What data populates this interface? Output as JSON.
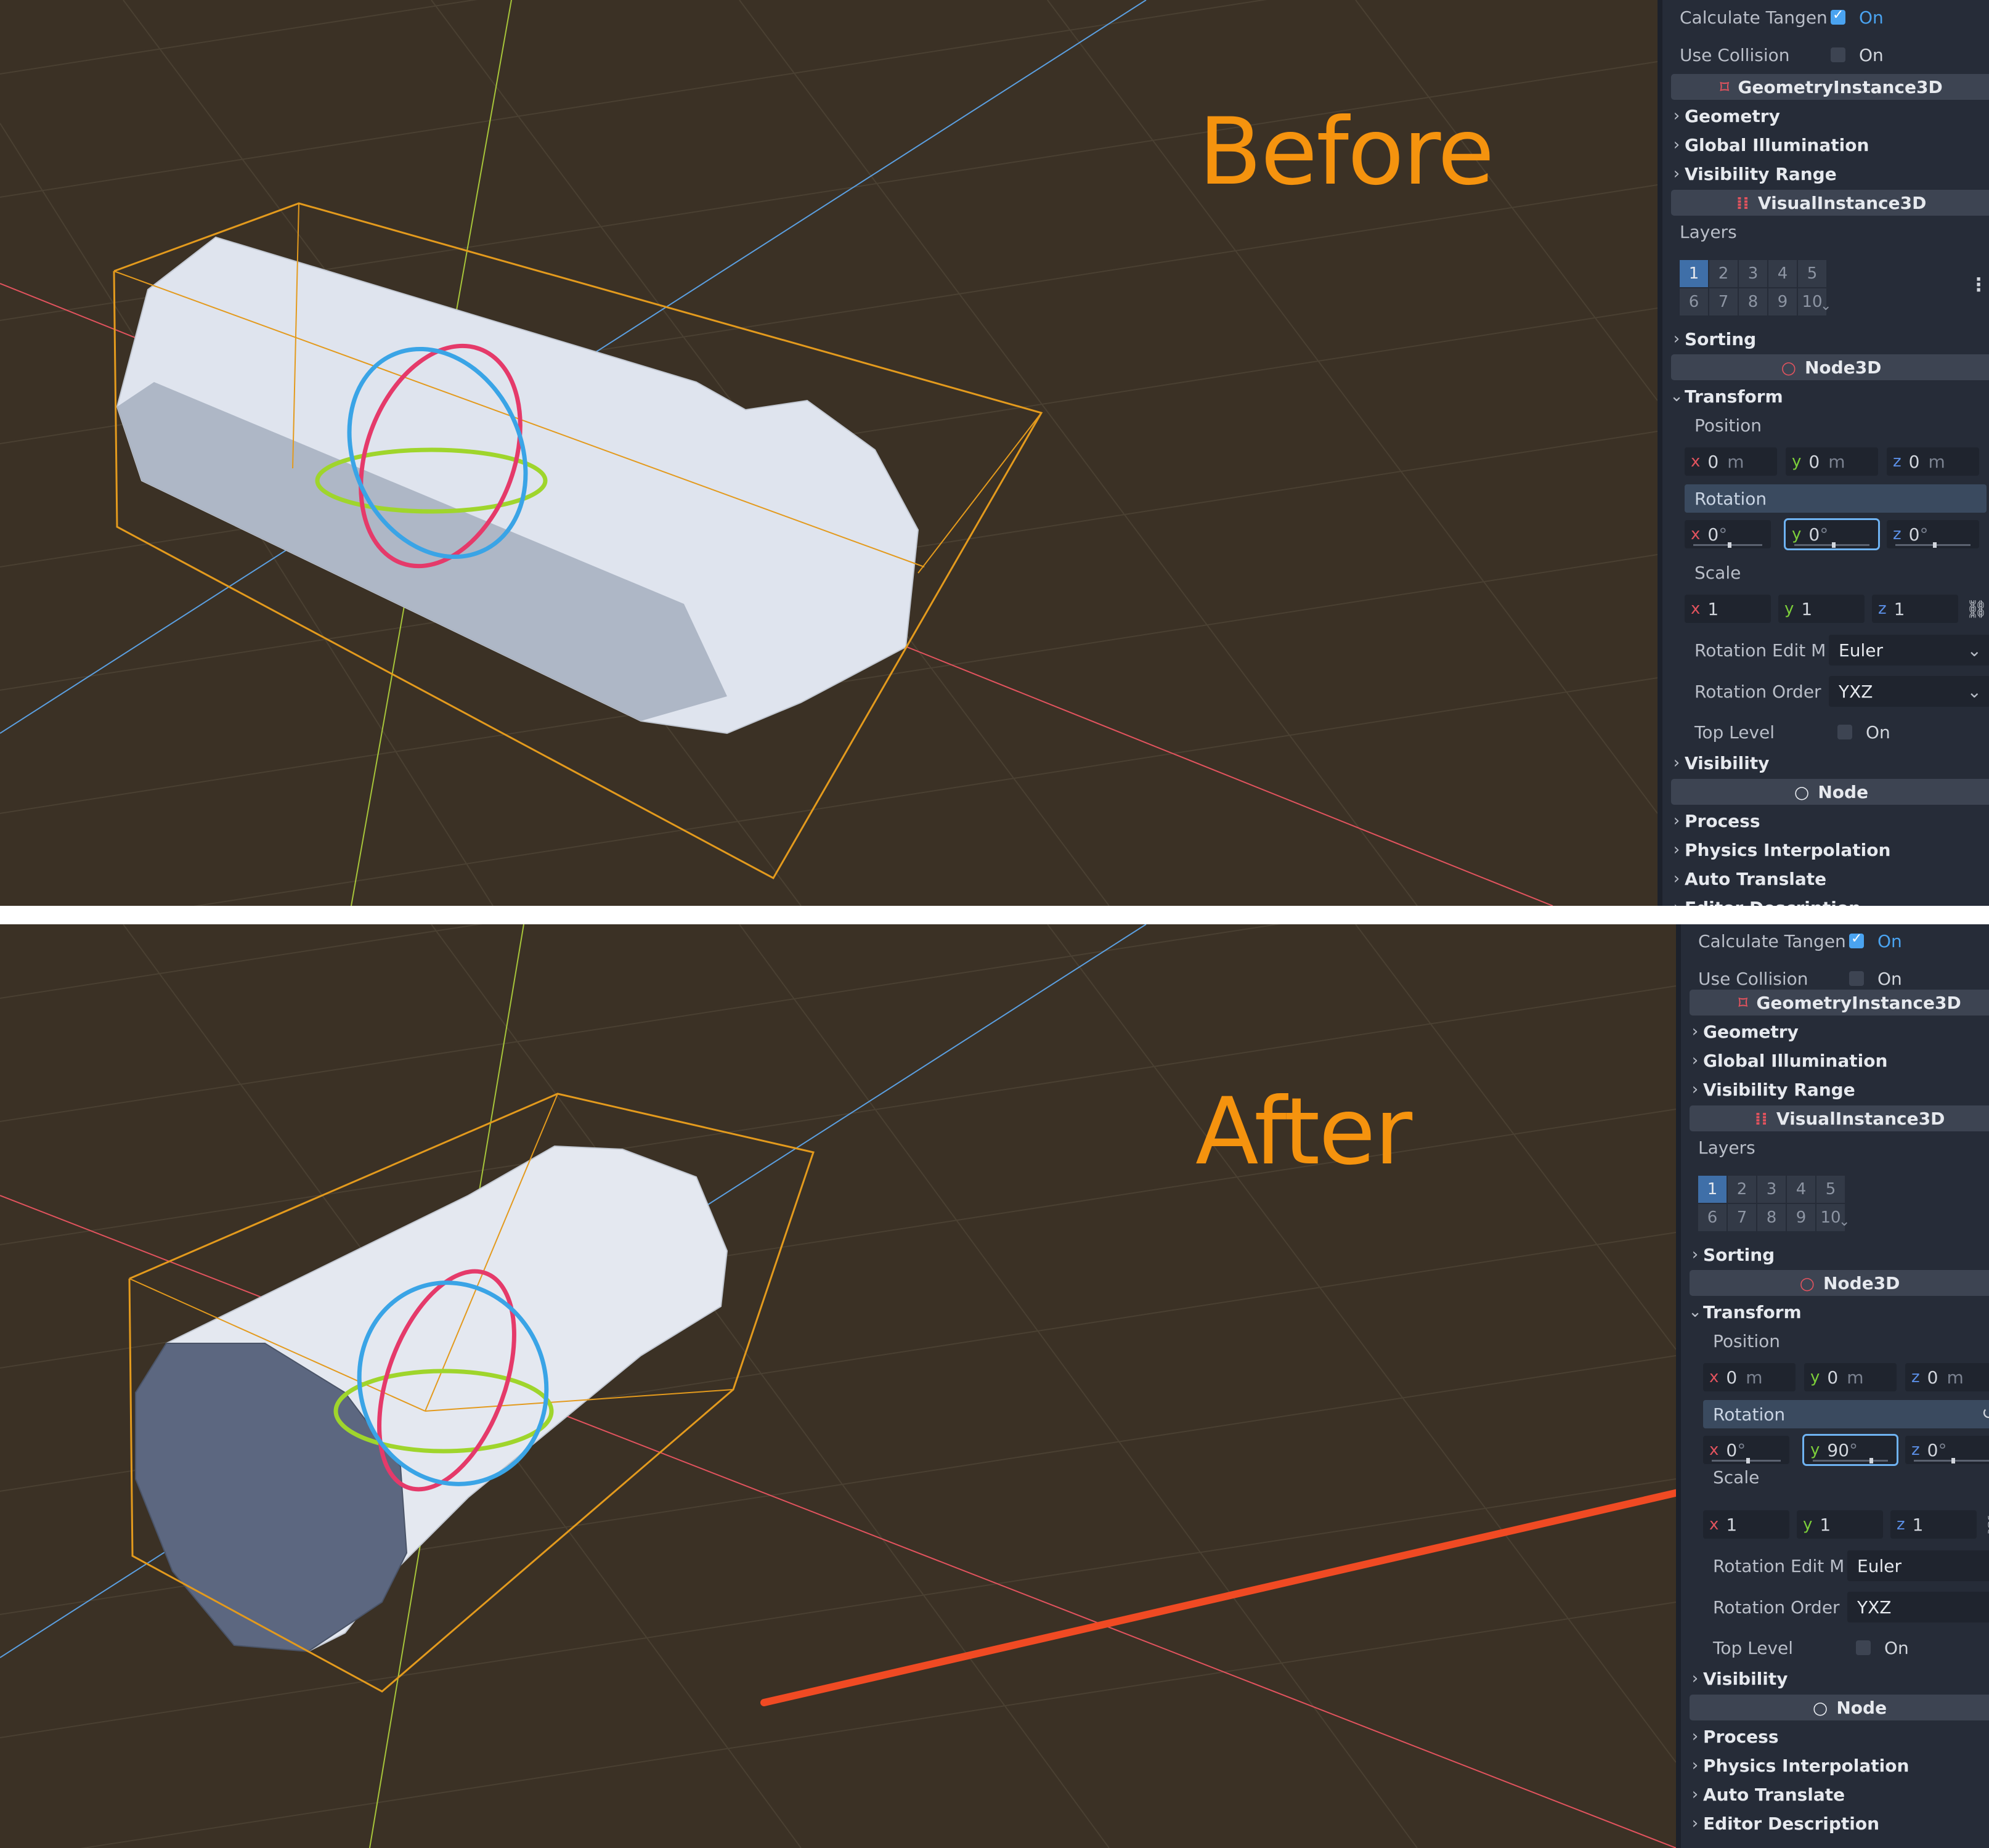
{
  "panels": [
    {
      "label": "Before",
      "inspector": {
        "calculate_tangents": {
          "label": "Calculate Tangen",
          "value": "On",
          "checked": true
        },
        "use_collision": {
          "label": "Use Collision",
          "value": "On",
          "checked": false
        },
        "geometry_instance_header": "GeometryInstance3D",
        "sections_a": [
          "Geometry",
          "Global Illumination",
          "Visibility Range"
        ],
        "visual_instance_header": "VisualInstance3D",
        "layers_label": "Layers",
        "layers": [
          "1",
          "2",
          "3",
          "4",
          "5",
          "6",
          "7",
          "8",
          "9",
          "10"
        ],
        "sorting": "Sorting",
        "node3d_header": "Node3D",
        "transform": "Transform",
        "position": {
          "label": "Position",
          "x": "0",
          "y": "0",
          "z": "0",
          "unit": "m"
        },
        "rotation": {
          "label": "Rotation",
          "x": "0",
          "y": "0",
          "z": "0",
          "unit": "°"
        },
        "scale": {
          "label": "Scale",
          "x": "1",
          "y": "1",
          "z": "1"
        },
        "rotation_edit_mode": {
          "label": "Rotation Edit M",
          "value": "Euler"
        },
        "rotation_order": {
          "label": "Rotation Order",
          "value": "YXZ"
        },
        "top_level": {
          "label": "Top Level",
          "value": "On",
          "checked": false
        },
        "visibility": "Visibility",
        "node_header": "Node",
        "sections_b": [
          "Process",
          "Physics Interpolation",
          "Auto Translate",
          "Editor Description"
        ]
      }
    },
    {
      "label": "After",
      "inspector": {
        "calculate_tangents": {
          "label": "Calculate Tangen",
          "value": "On",
          "checked": true
        },
        "use_collision": {
          "label": "Use Collision",
          "value": "On",
          "checked": false
        },
        "geometry_instance_header": "GeometryInstance3D",
        "sections_a": [
          "Geometry",
          "Global Illumination",
          "Visibility Range"
        ],
        "visual_instance_header": "VisualInstance3D",
        "layers_label": "Layers",
        "layers": [
          "1",
          "2",
          "3",
          "4",
          "5",
          "6",
          "7",
          "8",
          "9",
          "10"
        ],
        "sorting": "Sorting",
        "node3d_header": "Node3D",
        "transform": "Transform",
        "position": {
          "label": "Position",
          "x": "0",
          "y": "0",
          "z": "0",
          "unit": "m"
        },
        "rotation": {
          "label": "Rotation",
          "x": "0",
          "y": "90",
          "z": "0",
          "unit": "°"
        },
        "scale": {
          "label": "Scale",
          "x": "1",
          "y": "1",
          "z": "1"
        },
        "rotation_edit_mode": {
          "label": "Rotation Edit M",
          "value": "Euler"
        },
        "rotation_order": {
          "label": "Rotation Order",
          "value": "YXZ"
        },
        "top_level": {
          "label": "Top Level",
          "value": "On",
          "checked": false
        },
        "visibility": "Visibility",
        "node_header": "Node",
        "sections_b": [
          "Process",
          "Physics Interpolation",
          "Auto Translate",
          "Editor Description"
        ]
      }
    }
  ],
  "colors": {
    "viewport_bg": "#3b3125",
    "label_orange": "#f5930e",
    "selection_box": "#e39a1d",
    "arrow": "#f04a23",
    "axis_x": "#e2535e",
    "axis_y": "#7ccf3a",
    "axis_z": "#5b8fe6"
  }
}
